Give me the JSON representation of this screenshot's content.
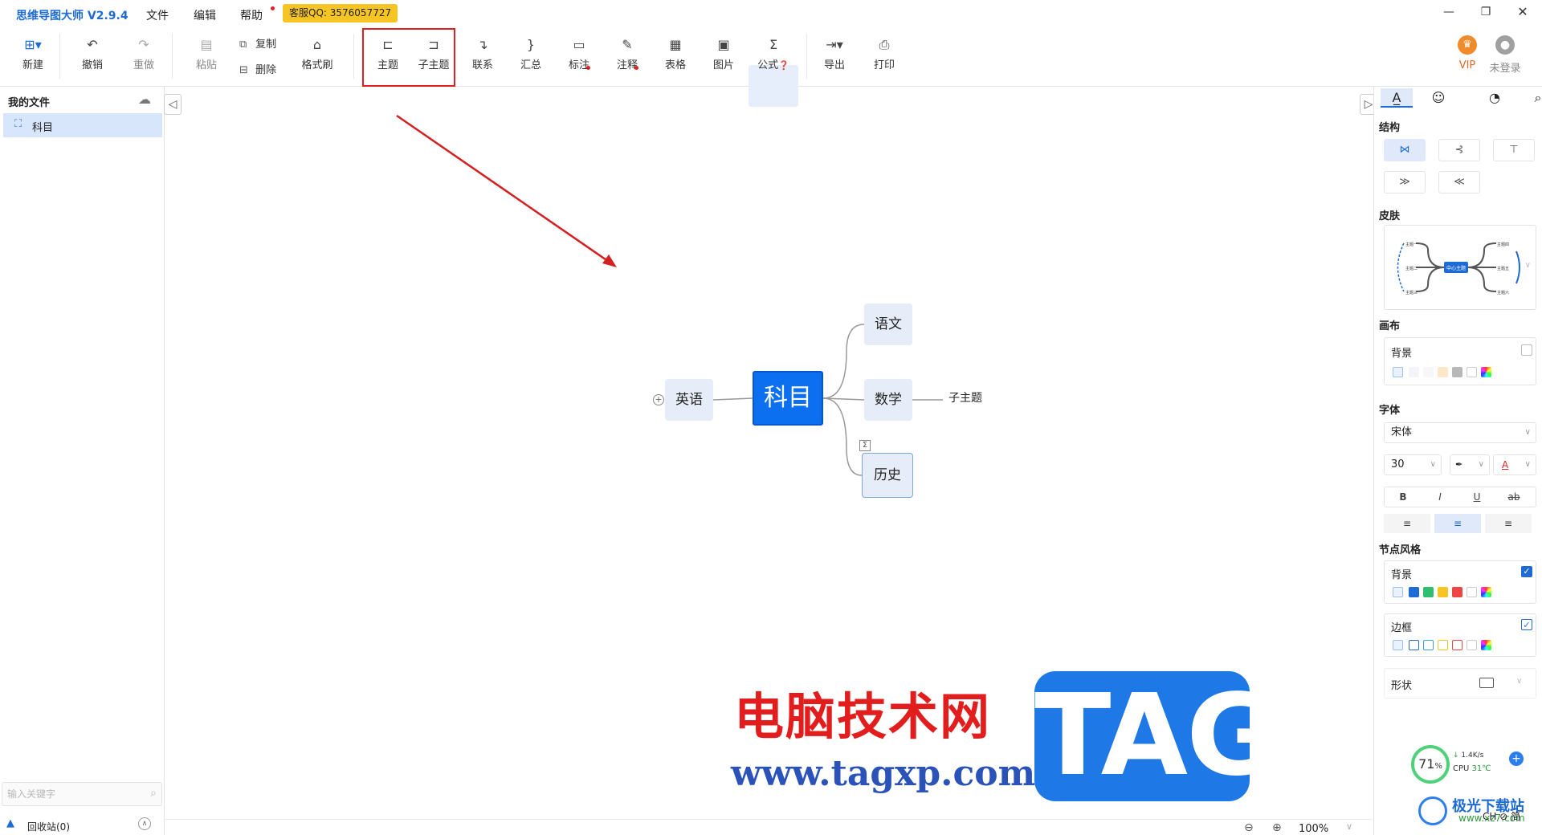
{
  "app": {
    "title": "思维导图大师 V2.9.4",
    "qq": "客服QQ: 3576057727"
  },
  "menu": {
    "file": "文件",
    "edit": "编辑",
    "help": "帮助"
  },
  "window": {
    "minimize": "—",
    "restore": "❐",
    "close": "✕"
  },
  "toolbar": {
    "new": "新建",
    "undo": "撤销",
    "redo": "重做",
    "paste": "粘贴",
    "copy": "复制",
    "delete": "删除",
    "format_brush": "格式刷",
    "topic": "主题",
    "subtopic": "子主题",
    "relation": "联系",
    "summary": "汇总",
    "marker": "标注",
    "note": "注释",
    "table": "表格",
    "image": "图片",
    "formula": "公式",
    "export": "导出",
    "print": "打印",
    "vip": "VIP",
    "login": "未登录"
  },
  "left_panel": {
    "title": "我的文件",
    "files": [
      {
        "name": "科目"
      }
    ],
    "search_placeholder": "输入关键字",
    "recycle": "回收站(0)"
  },
  "mindmap": {
    "root": "科目",
    "children": [
      {
        "label": "语文"
      },
      {
        "label": "数学",
        "children": [
          {
            "label": "子主题"
          }
        ]
      },
      {
        "label": "历史"
      },
      {
        "label": "英语"
      }
    ]
  },
  "zoom": {
    "level": "100%"
  },
  "right_panel": {
    "structure": "结构",
    "skin": "皮肤",
    "canvas": "画布",
    "canvas_bg": "背景",
    "font": "字体",
    "font_family": "宋体",
    "font_size": "30",
    "node_style": "节点风格",
    "node_bg": "背景",
    "node_border": "边框",
    "shape": "形状",
    "format_buttons": [
      "B",
      "I",
      "U",
      "ab"
    ],
    "skin_preview": {
      "center": "中心主题",
      "branches": [
        "主题一",
        "主题二",
        "主题三",
        "主题四",
        "主题五",
        "主题六"
      ]
    }
  },
  "colors": {
    "accent": "#0b6ff0",
    "node_bg": "#e6edf8",
    "highlight_box": "#e02020",
    "node_swatches": [
      "#1e6bd6",
      "#2fbf71",
      "#f6c524",
      "#ef4444"
    ],
    "border_swatches": [
      "#1e6bd6",
      "#3aa0d8",
      "#f6c524",
      "#ef4444"
    ],
    "canvas_swatches": [
      "#f2f4f7",
      "#f7f7f7",
      "#fde7c8",
      "#b8b8b8"
    ]
  },
  "watermark": {
    "cn": "电脑技术网",
    "url": "www.tagxp.com",
    "tag": "TAG",
    "site": "极光下载站",
    "site_url": "www.xz7.com"
  },
  "system": {
    "perf": "71",
    "perf_unit": "%",
    "net": "1.4K/s",
    "cpu": "CPU",
    "cpu_temp": "31℃",
    "ime": "CH ⊘ 简"
  }
}
